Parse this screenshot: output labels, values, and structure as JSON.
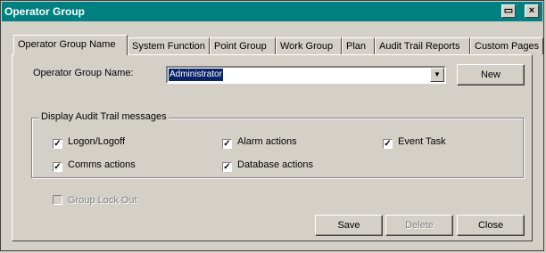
{
  "window": {
    "title": "Operator Group",
    "restore_icon": "restore-icon",
    "close_label": "×"
  },
  "tabs": [
    {
      "label": "Operator Group Name",
      "active": true
    },
    {
      "label": "System Function"
    },
    {
      "label": "Point Group"
    },
    {
      "label": "Work Group"
    },
    {
      "label": "Plan"
    },
    {
      "label": "Audit Trail Reports"
    },
    {
      "label": "Custom Pages"
    }
  ],
  "form": {
    "name_label": "Operator Group Name:",
    "name_value": "Administrator",
    "new_button": "New"
  },
  "audit": {
    "group_label": "Display Audit Trail messages",
    "checkboxes": [
      {
        "label": "Logon/Logoff",
        "checked": true
      },
      {
        "label": "Alarm actions",
        "checked": true
      },
      {
        "label": "Event Task",
        "checked": true
      },
      {
        "label": "Comms actions",
        "checked": true
      },
      {
        "label": "Database actions",
        "checked": true
      }
    ]
  },
  "lockout": {
    "label": "Group Lock Out",
    "checked": false,
    "enabled": false
  },
  "buttons": {
    "save": "Save",
    "delete": "Delete",
    "close": "Close"
  }
}
